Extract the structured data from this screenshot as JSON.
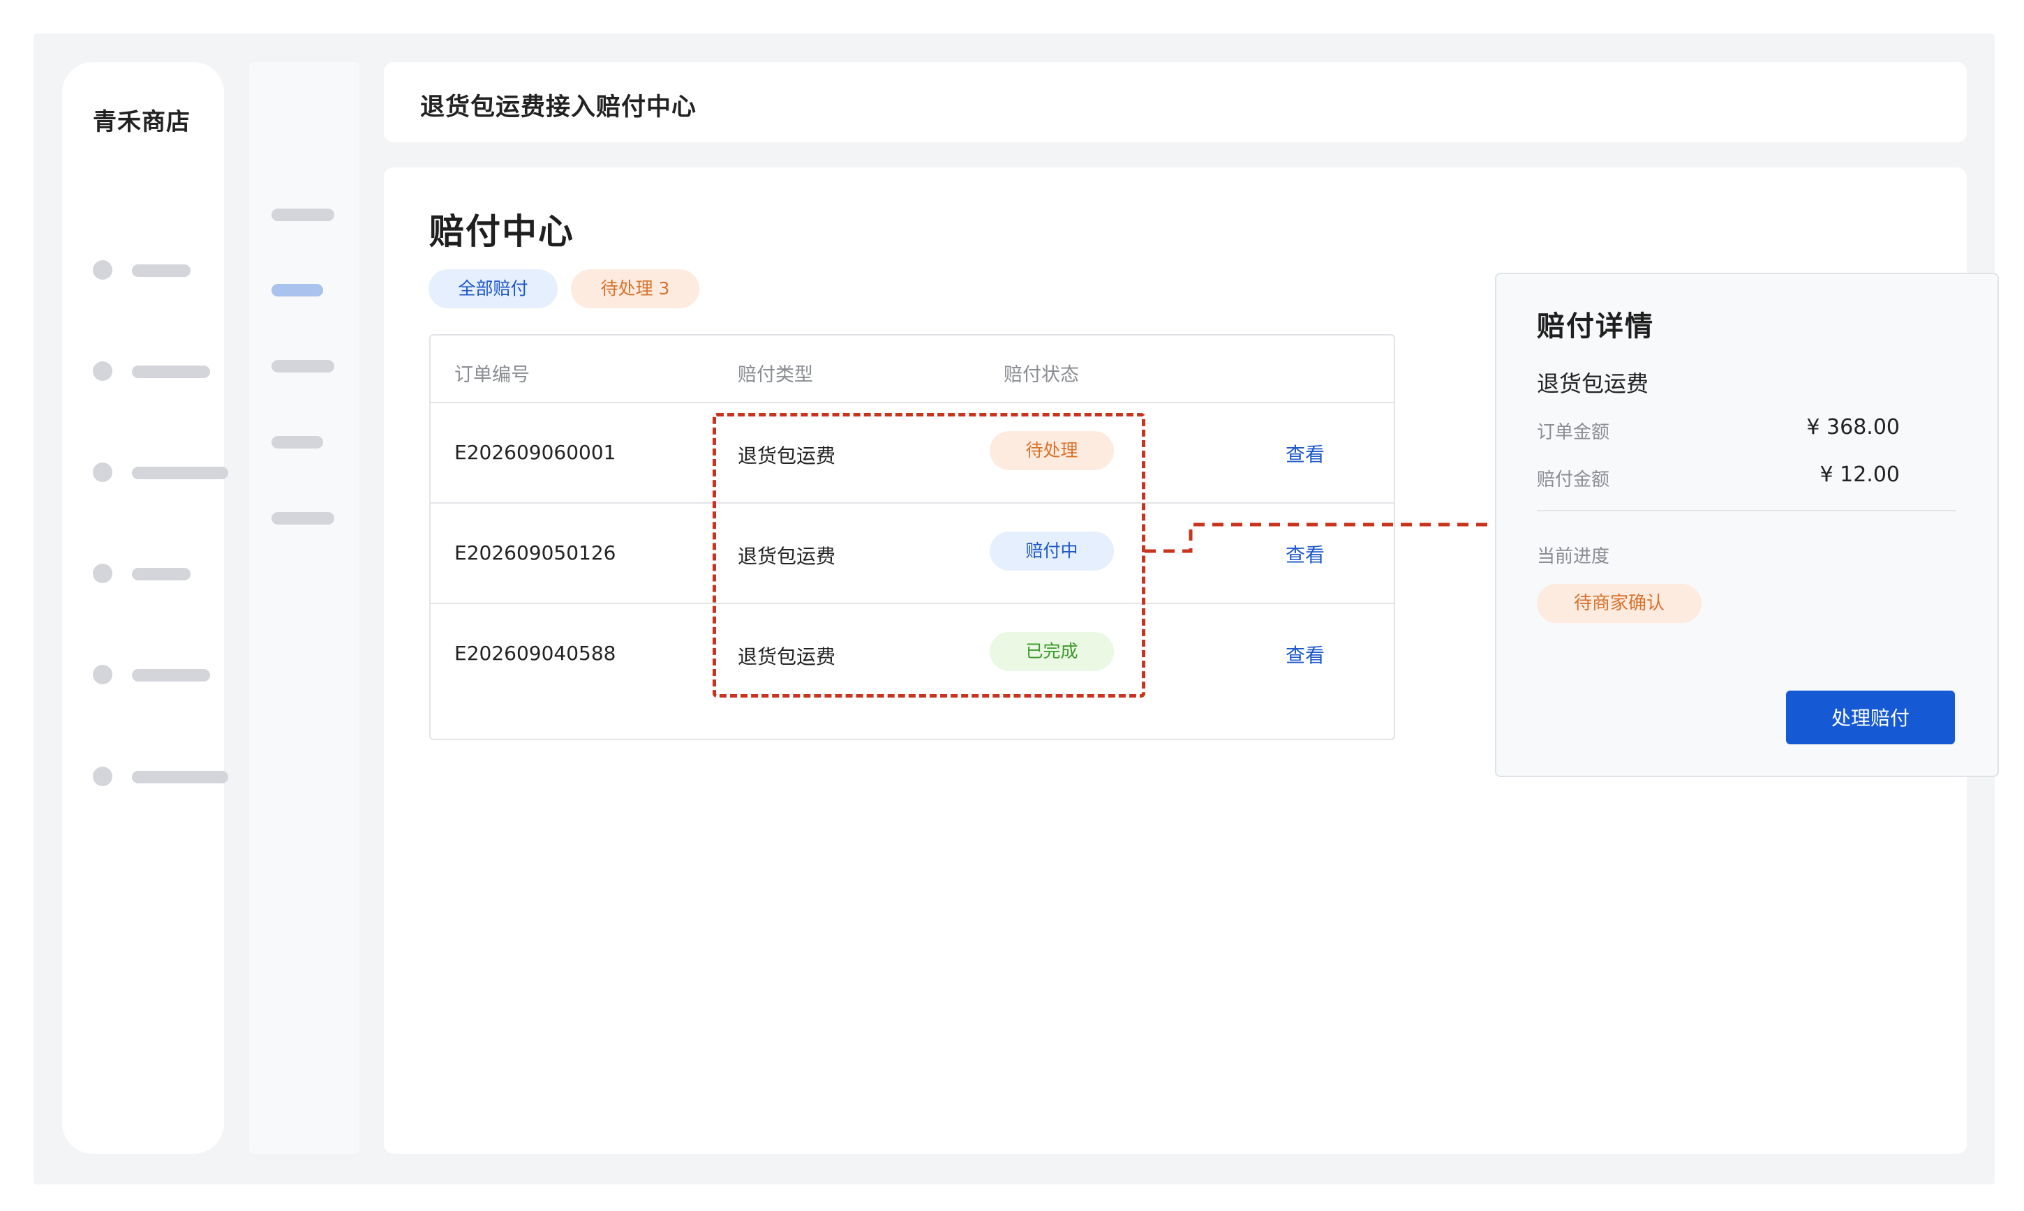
{
  "sidebar": {
    "shop_name": "青禾商店"
  },
  "header": {
    "title": "退货包运费接入赔付中心"
  },
  "page": {
    "title": "赔付中心",
    "tabs": [
      {
        "label": "全部赔付"
      },
      {
        "label": "待处理 3"
      }
    ]
  },
  "table": {
    "columns": [
      "订单编号",
      "赔付类型",
      "赔付状态"
    ],
    "rows": [
      {
        "order_id": "E202609060001",
        "type": "退货包运费",
        "status": "待处理",
        "action": "查看"
      },
      {
        "order_id": "E202609050126",
        "type": "退货包运费",
        "status": "赔付中",
        "action": "查看"
      },
      {
        "order_id": "E202609040588",
        "type": "退货包运费",
        "status": "已完成",
        "action": "查看"
      }
    ]
  },
  "detail": {
    "title": "赔付详情",
    "subtitle": "退货包运费",
    "order_amount_label": "订单金额",
    "order_amount": "¥ 368.00",
    "claim_amount_label": "赔付金额",
    "claim_amount": "¥ 12.00",
    "progress_label": "当前进度",
    "progress_status": "待商家确认",
    "action_label": "处理赔付"
  },
  "colors": {
    "accent": "#1559d4",
    "annotation": "#c9341f",
    "pending": "#d9722b",
    "done": "#3b9b2a"
  }
}
